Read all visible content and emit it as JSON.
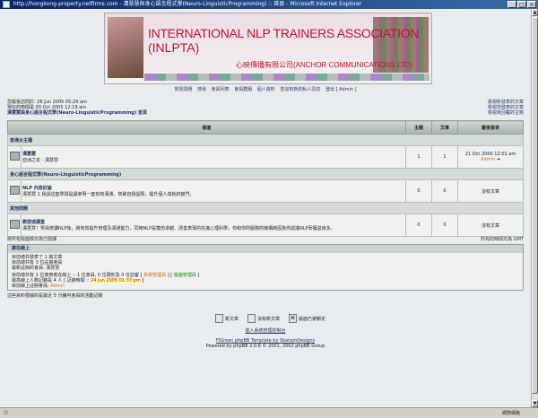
{
  "window": {
    "title": "http://hongkong-property.netfirms.com - 溝慧慧與身心語言程式學(Neuro-LinguisticProgramming) :: 首頁 - Microsoft Internet Explorer",
    "min": "_",
    "max": "□",
    "close": "×"
  },
  "banner": {
    "line1": "INTERNATIONAL NLP TRAINERS ASSOCIATION",
    "line2": "(INLPTA)",
    "line3": "心映傳播有限公司(ANCHOR COMMUNICATIONS LTD)"
  },
  "nav": [
    "常見問題",
    "搜尋",
    "會員列表",
    "會員群組",
    "個人資料",
    "您沒有新的私人訊息",
    "登出 [ Admin ]"
  ],
  "info": {
    "last_visit": "您最後訪問於: 26 Jun 2005 05:29 am",
    "now": "現在的時間是 03 Oct 2005 12:19 am",
    "forum_index": "溝慧慧與身心語言程式學(Neuro-LinguisticProgramming) 首頁",
    "links": [
      "檢視新發表的文章",
      "檢視您發表的文章",
      "檢視未回覆的主題"
    ]
  },
  "table": {
    "headers": {
      "forum": "版面",
      "topics": "主題",
      "posts": "文章",
      "last": "最後發表"
    },
    "categories": [
      {
        "name": "普通女主播",
        "forums": [
          {
            "name": "溝慧慧",
            "desc": "亞洲之花 - 溝慧慧",
            "topics": "1",
            "posts": "1",
            "last_date": "21 Oct 2000 12:01 am",
            "last_user": "Admin"
          }
        ]
      },
      {
        "name": "身心語言程式學(Neuro-LinguisticProgramming)",
        "forums": [
          {
            "name": "NLP 內容討論",
            "desc": "溝慧慧 1 我說這套學問是讓家明一套有效溝通、突破自我設限，提升個人成就的竅門。",
            "topics": "0",
            "posts": "0",
            "last_date": "沒有文章",
            "last_user": ""
          }
        ]
      },
      {
        "name": "其他問題",
        "forums": [
          {
            "name": "教授或講堂",
            "desc": "溝慧慧！學員修讀NLP後，將有效提升管理及溝通能力，同時NLP是模仿卓越、改善表現的先進心理科學，你和你所服務的機構將因為你認識NLP而獲益良多。",
            "topics": "0",
            "posts": "0",
            "last_date": "沒有文章",
            "last_user": ""
          }
        ]
      }
    ]
  },
  "footnote": {
    "left": "將所有版面標示為已閱讀",
    "right": "所有的時間均為 GMT"
  },
  "online": {
    "header": "誰在線上",
    "line1": "目前總共發表了 1 篇文章",
    "line2": "目前總共有 3 位註冊會員",
    "line3": "最新註冊的會員: 溝慧慧",
    "line4": "目前總共有 1 位使用者在線上 :: 1 位會員, 0 位隱形及 0 位訪客",
    "admin_label": "系統管理員",
    "mod_label": "版面管理員",
    "line5": "最高線上人數記錄是 4 人 [ 記錄時間 ::",
    "record_time": "24 Jun 2005 01:37 pm",
    "line6": "目前線上註冊會員:",
    "online_user": "Admin"
  },
  "note": "這些資料根據的是最近 5 分鐘內會員的活動記錄",
  "legend": [
    "新文章",
    "沒有新文章",
    "版面已被鎖定"
  ],
  "footer": {
    "admin_link": "進入系統管理控制台",
    "template": "FIGreen phpBB Template by SkaisonDesigns",
    "powered": "Powered by phpBB 2.0.6 © 2001, 2002 phpBB Group"
  },
  "statusbar": {
    "zone": "網際網路"
  }
}
